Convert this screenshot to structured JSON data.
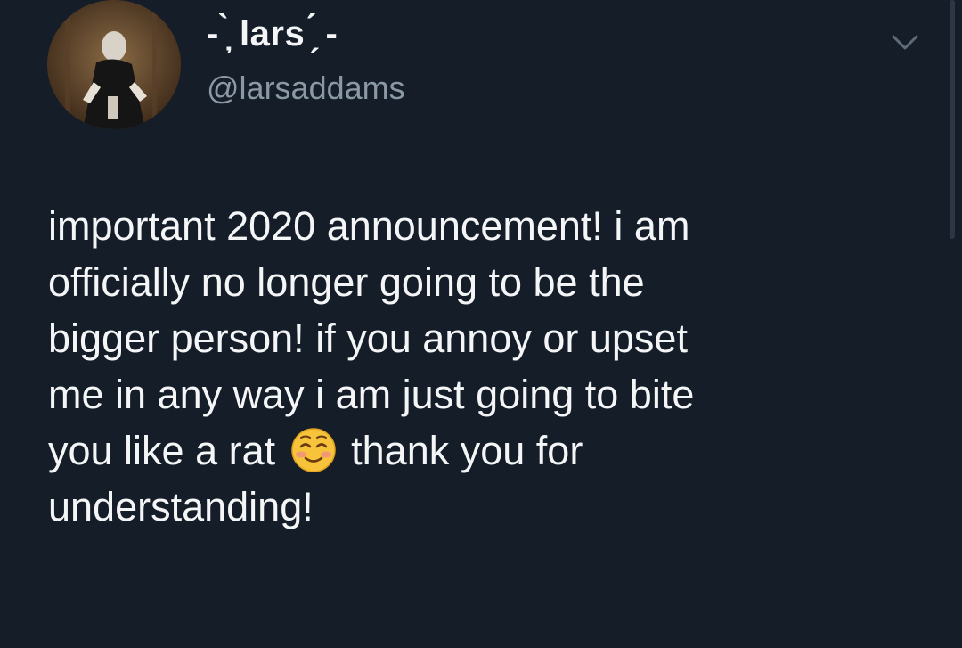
{
  "user": {
    "display_name": "- ̦̀ lars ̗́ -",
    "handle": "@larsaddams"
  },
  "icons": {
    "menu": "chevron-down-icon",
    "emoji": "smiling-face-with-blush-emoji"
  },
  "tweet": {
    "lines": [
      "important 2020 announcement! i am",
      "officially no longer going to be the",
      "bigger person! if you annoy or upset",
      "me in any way i am just going to bite"
    ],
    "line5_before_emoji": "you like a rat",
    "line5_after_emoji": "thank you for",
    "line6": "understanding!"
  },
  "colors": {
    "background": "#151d28",
    "primary_text": "#f4f5f7",
    "secondary_text": "#8b98a5"
  }
}
